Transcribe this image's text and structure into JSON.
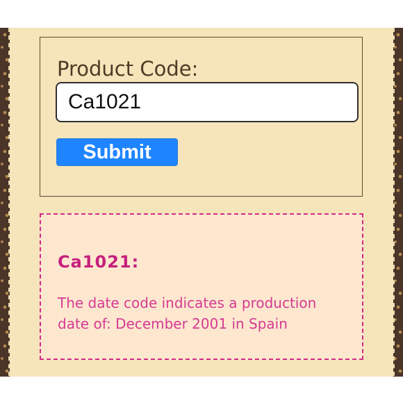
{
  "form": {
    "label": "Product Code:",
    "input_value": "Ca1021",
    "submit_label": "Submit"
  },
  "result": {
    "code_heading": "Ca1021:",
    "message": "The date code indicates a production date of: December 2001 in Spain"
  },
  "colors": {
    "panel_background": "#f6e4ba",
    "border_dark": "#4a3528",
    "submit_background": "#1f84ff",
    "result_accent": "#d02a86",
    "result_background": "#fde7cf"
  },
  "icons": [
    "monogram-pattern-border"
  ]
}
